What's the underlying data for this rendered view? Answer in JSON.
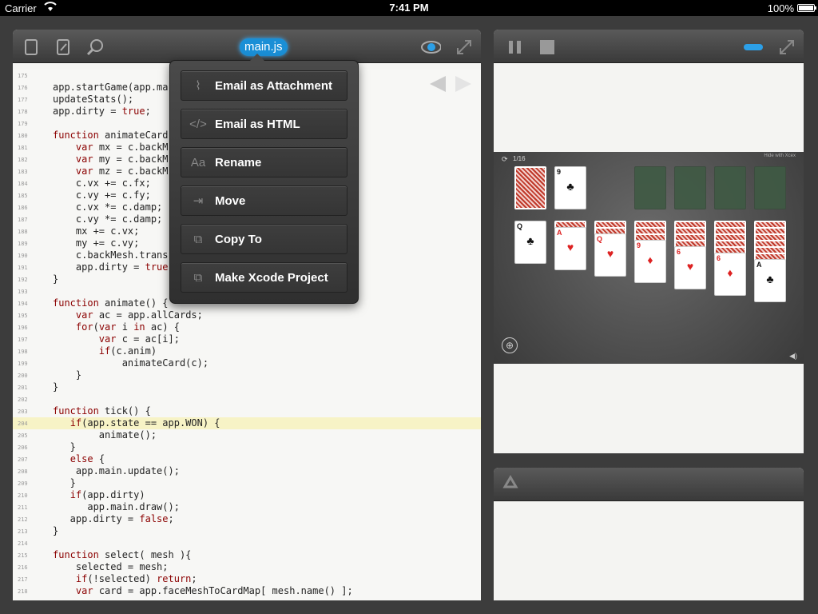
{
  "status": {
    "carrier": "Carrier",
    "time": "7:41 PM",
    "battery": "100%"
  },
  "editor": {
    "filename": "main.js",
    "lines": [
      {
        "n": "175",
        "t": ""
      },
      {
        "n": "176",
        "t": "app.startGame(app.ma"
      },
      {
        "n": "177",
        "t": "updateStats();"
      },
      {
        "n": "178",
        "t": "app.dirty = true;"
      },
      {
        "n": "179",
        "t": ""
      },
      {
        "n": "180",
        "t": "function animateCard"
      },
      {
        "n": "181",
        "t": "    var mx = c.backM"
      },
      {
        "n": "182",
        "t": "    var my = c.backM"
      },
      {
        "n": "183",
        "t": "    var mz = c.backM"
      },
      {
        "n": "184",
        "t": "    c.vx += c.fx;"
      },
      {
        "n": "185",
        "t": "    c.vy += c.fy;"
      },
      {
        "n": "186",
        "t": "    c.vx *= c.damp;"
      },
      {
        "n": "187",
        "t": "    c.vy *= c.damp;"
      },
      {
        "n": "188",
        "t": "    mx += c.vx;"
      },
      {
        "n": "189",
        "t": "    my += c.vy;"
      },
      {
        "n": "190",
        "t": "    c.backMesh.trans"
      },
      {
        "n": "191",
        "t": "    app.dirty = true"
      },
      {
        "n": "192",
        "t": "}"
      },
      {
        "n": "193",
        "t": ""
      },
      {
        "n": "194",
        "t": "function animate() {"
      },
      {
        "n": "195",
        "t": "    var ac = app.allCards;"
      },
      {
        "n": "196",
        "t": "    for(var i in ac) {"
      },
      {
        "n": "197",
        "t": "        var c = ac[i];"
      },
      {
        "n": "198",
        "t": "        if(c.anim)"
      },
      {
        "n": "199",
        "t": "            animateCard(c);"
      },
      {
        "n": "200",
        "t": "    }"
      },
      {
        "n": "201",
        "t": "}"
      },
      {
        "n": "202",
        "t": ""
      },
      {
        "n": "203",
        "t": "function tick() {"
      },
      {
        "n": "204",
        "t": "   if(app.state == app.WON) {"
      },
      {
        "n": "205",
        "t": "        animate();"
      },
      {
        "n": "206",
        "t": "   }"
      },
      {
        "n": "207",
        "t": "   else {"
      },
      {
        "n": "208",
        "t": "    app.main.update();"
      },
      {
        "n": "209",
        "t": "   }"
      },
      {
        "n": "210",
        "t": "   if(app.dirty)"
      },
      {
        "n": "211",
        "t": "      app.main.draw();"
      },
      {
        "n": "212",
        "t": "   app.dirty = false;"
      },
      {
        "n": "213",
        "t": "}"
      },
      {
        "n": "214",
        "t": ""
      },
      {
        "n": "215",
        "t": "function select( mesh ){"
      },
      {
        "n": "216",
        "t": "    selected = mesh;"
      },
      {
        "n": "217",
        "t": "    if(!selected) return;"
      },
      {
        "n": "218",
        "t": "    var card = app.faceMeshToCardMap[ mesh.name() ];"
      }
    ],
    "highlighted_line": "204"
  },
  "menu": {
    "items": [
      {
        "label": "Email as Attachment",
        "icon": "paperclip-icon",
        "glyph": "⌇"
      },
      {
        "label": "Email as HTML",
        "icon": "code-icon",
        "glyph": "</>"
      },
      {
        "label": "Rename",
        "icon": "text-icon",
        "glyph": "Aa"
      },
      {
        "label": "Move",
        "icon": "move-icon",
        "glyph": "⇥"
      },
      {
        "label": "Copy To",
        "icon": "copy-icon",
        "glyph": "⧉"
      },
      {
        "label": "Make Xcode Project",
        "icon": "xcode-icon",
        "glyph": "⧉"
      }
    ]
  },
  "game": {
    "counter": "1/16",
    "note": "Hide with Xcex",
    "cards": [
      {
        "rank": "Q",
        "suit": "♣",
        "color": "blk"
      },
      {
        "rank": "A",
        "suit": "♥",
        "color": "red"
      },
      {
        "rank": "Q",
        "suit": "♥",
        "color": "red"
      },
      {
        "rank": "9",
        "suit": "♦",
        "color": "red"
      },
      {
        "rank": "6",
        "suit": "♥",
        "color": "red"
      },
      {
        "rank": "6",
        "suit": "♦",
        "color": "red"
      },
      {
        "rank": "A",
        "suit": "♣",
        "color": "blk"
      },
      {
        "rank": "9",
        "suit": "♣",
        "color": "blk"
      }
    ]
  },
  "colors": {
    "accent": "#1a8fd6",
    "highlight": "#f7f3c6",
    "keyword": "#8b0000"
  }
}
